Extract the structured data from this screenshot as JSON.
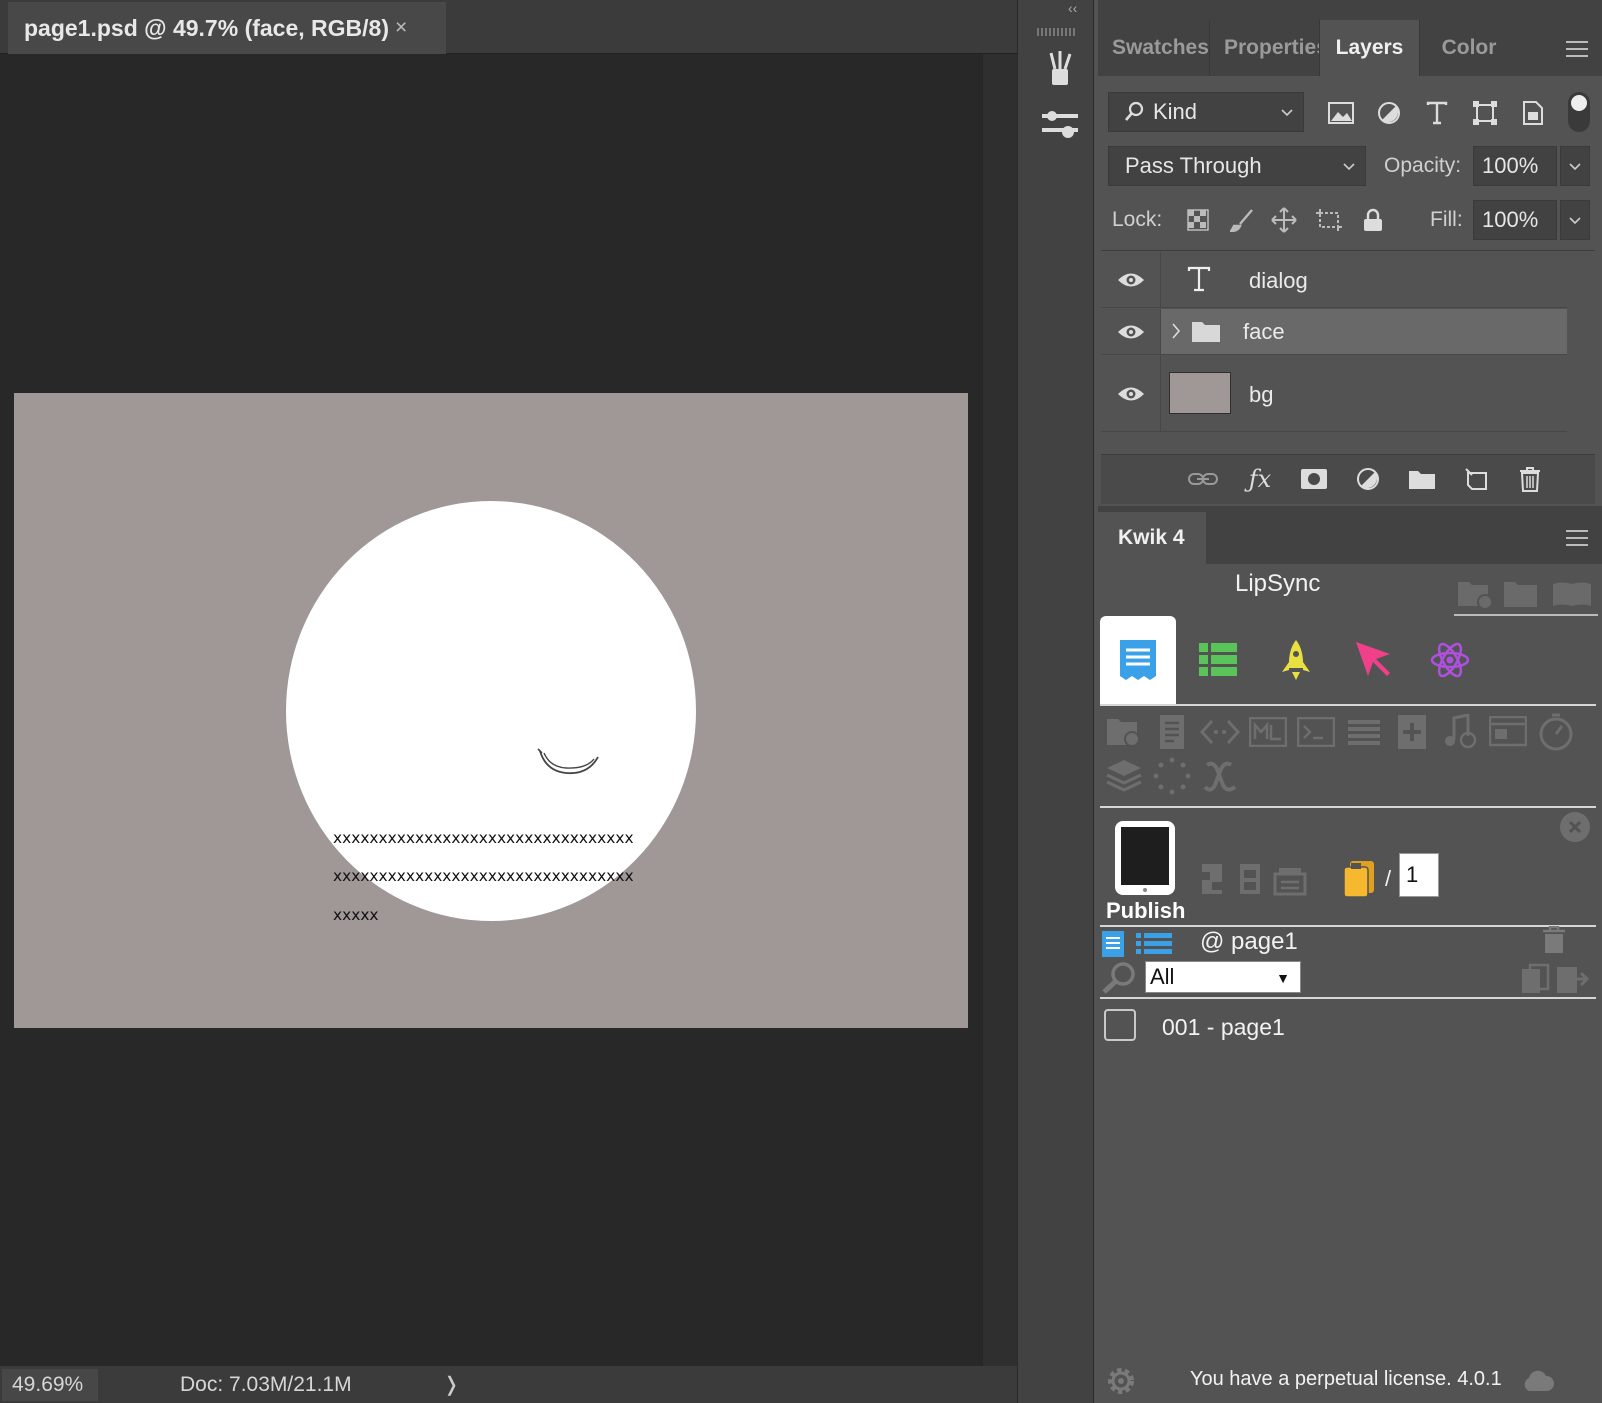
{
  "document": {
    "tab_title": "page1.psd @ 49.7% (face, RGB/8)",
    "tab_close": "×",
    "canvas": {
      "text_lines": [
        "xxxxxxxxxxxxxxxxxxxxxxxxxxxxxxxxx",
        "xxxxxxxxxxxxxxxxxxxxxxxxxxxxxxxxx",
        "xxxxx"
      ],
      "background_color": "#a09797",
      "face_color": "#ffffff"
    },
    "status": {
      "zoom": "49.69%",
      "doc_info": "Doc: 7.03M/21.1M",
      "arrow": "❭"
    }
  },
  "toolstrip": {
    "collapse_left": "‹‹",
    "collapse_right": "››",
    "tools": [
      "brushes-icon",
      "adjustments-icon"
    ]
  },
  "layers_panel": {
    "tabs": [
      {
        "label": "Swatches",
        "active": false
      },
      {
        "label": "Properties",
        "active": false
      },
      {
        "label": "Layers",
        "active": true
      },
      {
        "label": "Color",
        "active": false
      }
    ],
    "filter_kind": "Kind",
    "blend_mode": "Pass Through",
    "opacity_label": "Opacity:",
    "opacity_value": "100%",
    "lock_label": "Lock:",
    "fill_label": "Fill:",
    "fill_value": "100%",
    "layers": [
      {
        "name": "dialog",
        "type": "text",
        "visible": true,
        "selected": false
      },
      {
        "name": "face",
        "type": "group",
        "visible": true,
        "selected": true
      },
      {
        "name": "bg",
        "type": "pixel",
        "visible": true,
        "selected": false,
        "thumb_color": "#a09797"
      }
    ]
  },
  "kwik_panel": {
    "tab_label": "Kwik 4",
    "section_title": "LipSync",
    "categories": [
      {
        "name": "pages",
        "color": "#3aa0e8",
        "active": true
      },
      {
        "name": "list",
        "color": "#5ac45a",
        "active": false
      },
      {
        "name": "rocket",
        "color": "#e8e040",
        "active": false
      },
      {
        "name": "pointer",
        "color": "#f0408a",
        "active": false
      },
      {
        "name": "atom",
        "color": "#b050e0",
        "active": false
      }
    ],
    "publish_label": "Publish",
    "page_separator": "/",
    "page_count": "1",
    "page_header": "@ page1",
    "filter_value": "All",
    "filter_arrow": "▼",
    "pages": [
      "001 - page1"
    ],
    "license_text": "You have a perpetual license. 4.0.1"
  }
}
